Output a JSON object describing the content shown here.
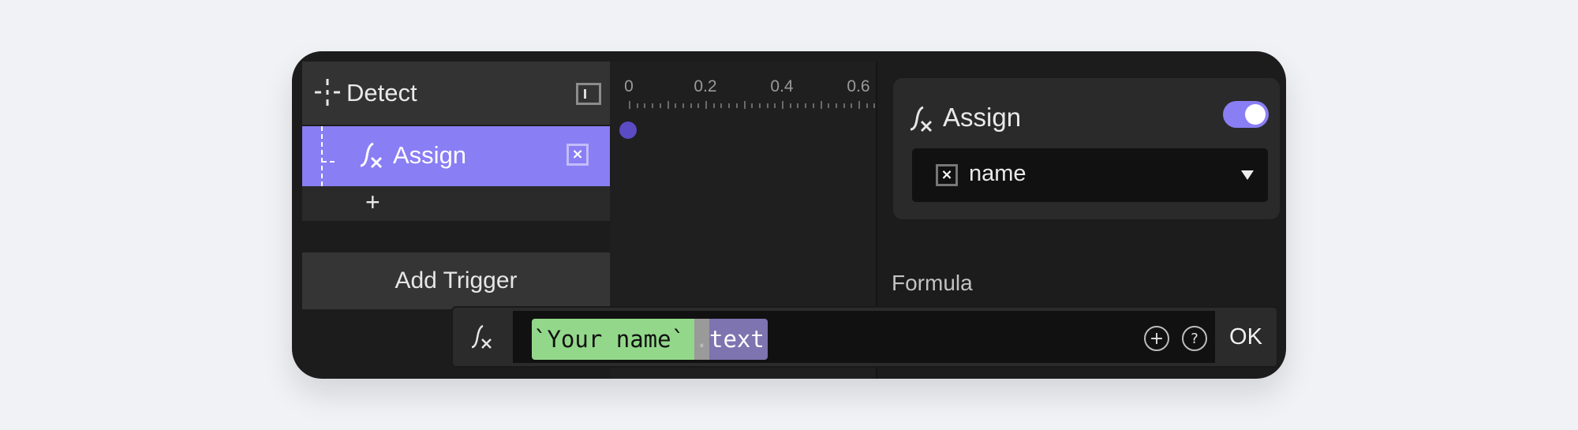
{
  "layers": {
    "detect": {
      "label": "Detect",
      "icon": "crosshair-icon",
      "action_icon": "panel-toggle-icon"
    },
    "assign": {
      "label": "Assign",
      "icon": "function-icon",
      "action_icon": "variable-box-icon",
      "selected": true
    },
    "add_child": {
      "label": "+"
    },
    "add_trigger_label": "Add Trigger"
  },
  "timeline": {
    "ticks": [
      "0",
      "0.2",
      "0.4",
      "0.6"
    ],
    "keyframe_time": 0
  },
  "inspector": {
    "title": "Assign",
    "icon": "function-icon",
    "enabled": true,
    "variable": {
      "value": "name",
      "icon": "variable-box-icon"
    },
    "formula_label": "Formula"
  },
  "formula_bar": {
    "icon": "function-icon",
    "tokens": [
      {
        "text": "`Your name`",
        "type": "layer",
        "color": "#93d88a"
      },
      {
        "text": ".",
        "type": "operator",
        "color": "#9a9a9a"
      },
      {
        "text": "text",
        "type": "property",
        "color": "#7d74b0"
      }
    ],
    "ok_label": "OK"
  },
  "colors": {
    "accent": "#8a7ef5",
    "keyframe": "#5b4bc4"
  }
}
